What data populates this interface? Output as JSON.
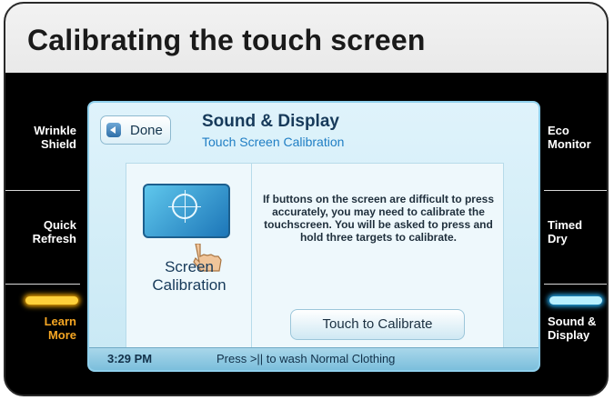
{
  "header": {
    "title": "Calibrating the touch screen"
  },
  "left_menu": [
    {
      "label_line1": "Wrinkle",
      "label_line2": "Shield"
    },
    {
      "label_line1": "Quick",
      "label_line2": "Refresh"
    },
    {
      "label_line1": "Learn",
      "label_line2": "More"
    }
  ],
  "right_menu": [
    {
      "label_line1": "Eco",
      "label_line2": "Monitor"
    },
    {
      "label_line1": "Timed",
      "label_line2": "Dry"
    },
    {
      "label_line1": "Sound &",
      "label_line2": "Display"
    }
  ],
  "screen": {
    "done_label": "Done",
    "title": "Sound & Display",
    "subtitle": "Touch Screen Calibration",
    "option_label_line1": "Screen",
    "option_label_line2": "Calibration",
    "description": "If buttons on the screen are difficult to press accurately, you may need to calibrate the touchscreen. You will be asked to press and hold three targets to calibrate.",
    "action_button": "Touch to Calibrate"
  },
  "status_bar": {
    "time": "3:29 PM",
    "message": "Press >|| to wash Normal Clothing"
  },
  "colors": {
    "learn_more_glow": "#ffb000",
    "sound_display_glow": "#27b7ff",
    "screen_accent": "#1f7ec4"
  }
}
